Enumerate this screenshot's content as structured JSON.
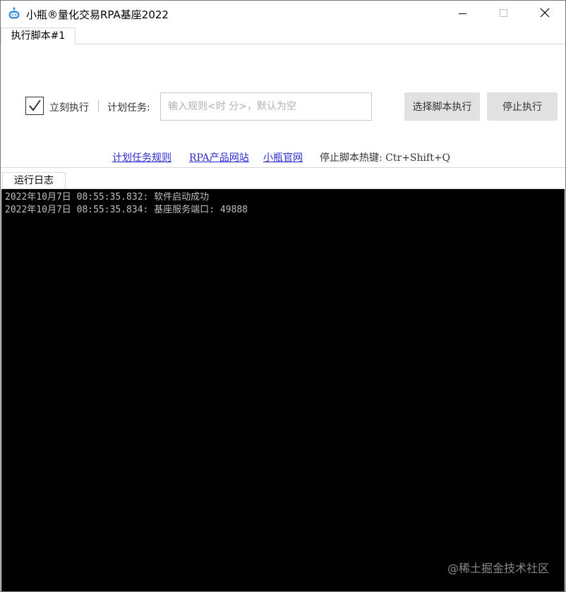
{
  "window": {
    "title": "小瓶®量化交易RPA基座2022",
    "icon": "robot-icon",
    "controls": [
      "minimize-icon",
      "maximize-icon",
      "close-icon"
    ]
  },
  "tabs": {
    "script_tab": "执行脚本#1",
    "log_tab": "运行日志"
  },
  "script_panel": {
    "immediate_checkbox": {
      "label": "立刻执行",
      "checked": true
    },
    "plan_label": "计划任务:",
    "rule_input": {
      "value": "",
      "placeholder": "输入规则<时 分>，默认为空"
    },
    "buttons": {
      "select": "选择脚本执行",
      "stop": "停止执行"
    },
    "links": {
      "rules": "计划任务规则",
      "site": "RPA产品网站",
      "official": "小瓶官网"
    },
    "hotkey_text": "停止脚本热键: Ctr+Shift+Q"
  },
  "log": {
    "lines": [
      "2022年10月7日 08:55:35.832: 软件启动成功",
      "2022年10月7日 08:55:35.834: 基座服务端口: 49888"
    ]
  },
  "watermark": "@稀土掘金技术社区",
  "colors": {
    "link": "#2b2bd6",
    "log_background": "#000000",
    "log_text": "#bfbfbf",
    "button_bg": "#e1e1e1"
  }
}
